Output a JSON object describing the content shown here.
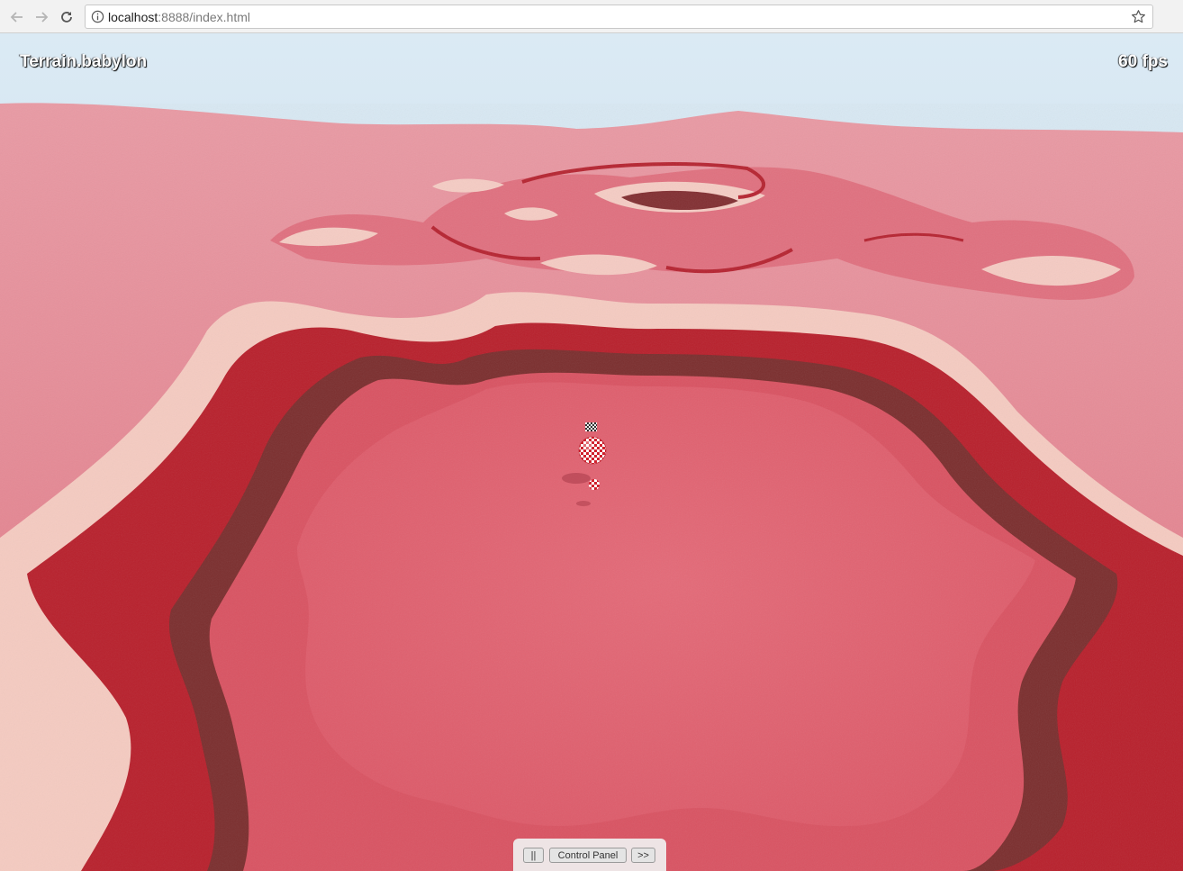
{
  "browser": {
    "url_host": "localhost",
    "url_rest": ":8888/index.html",
    "icons": {
      "back": "back-arrow-icon",
      "forward": "forward-arrow-icon",
      "reload": "reload-icon",
      "info": "info-icon",
      "bookmark": "star-icon"
    }
  },
  "scene": {
    "title": "Terrain.babylon",
    "fps": "60 fps",
    "colors": {
      "sky_top": "#d8e8f2",
      "sky_bottom": "#c3dbea",
      "terrain_pink": "#e57b8a",
      "center_pink": "#e0606f",
      "light_band": "#f7cfc4",
      "red_band": "#b8202c",
      "dark_band": "#7a2f2f"
    }
  },
  "controls": {
    "pause_label": "||",
    "panel_label": "Control Panel",
    "next_label": ">>"
  }
}
